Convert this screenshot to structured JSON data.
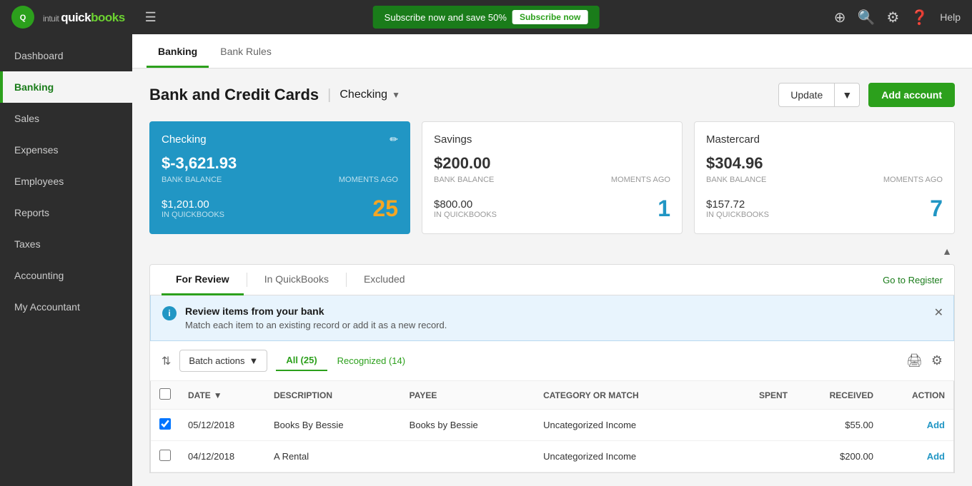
{
  "topnav": {
    "logo_text": "intuit",
    "brand_name": "quickbooks",
    "promo": {
      "text": "Subscribe now and save 50%",
      "button_label": "Subscribe now"
    },
    "help_label": "Help"
  },
  "sidebar": {
    "items": [
      {
        "id": "dashboard",
        "label": "Dashboard",
        "active": false
      },
      {
        "id": "banking",
        "label": "Banking",
        "active": true
      },
      {
        "id": "sales",
        "label": "Sales",
        "active": false
      },
      {
        "id": "expenses",
        "label": "Expenses",
        "active": false
      },
      {
        "id": "employees",
        "label": "Employees",
        "active": false
      },
      {
        "id": "reports",
        "label": "Reports",
        "active": false
      },
      {
        "id": "taxes",
        "label": "Taxes",
        "active": false
      },
      {
        "id": "accounting",
        "label": "Accounting",
        "active": false
      },
      {
        "id": "my-accountant",
        "label": "My Accountant",
        "active": false
      }
    ]
  },
  "tabs": [
    {
      "id": "banking",
      "label": "Banking",
      "active": true
    },
    {
      "id": "bank-rules",
      "label": "Bank Rules",
      "active": false
    }
  ],
  "page": {
    "title": "Bank and Credit Cards",
    "separator": "|",
    "account_selector": "Checking",
    "update_btn": "Update",
    "add_account_btn": "Add account"
  },
  "account_cards": [
    {
      "id": "checking",
      "name": "Checking",
      "active": true,
      "bank_balance": "$-3,621.93",
      "balance_label": "BANK BALANCE",
      "updated": "Moments ago",
      "qb_balance": "$1,201.00",
      "qb_label": "IN QUICKBOOKS",
      "count": "25",
      "count_color": "orange"
    },
    {
      "id": "savings",
      "name": "Savings",
      "active": false,
      "bank_balance": "$200.00",
      "balance_label": "BANK BALANCE",
      "updated": "Moments ago",
      "qb_balance": "$800.00",
      "qb_label": "IN QUICKBOOKS",
      "count": "1",
      "count_color": "blue"
    },
    {
      "id": "mastercard",
      "name": "Mastercard",
      "active": false,
      "bank_balance": "$304.96",
      "balance_label": "BANK BALANCE",
      "updated": "Moments ago",
      "qb_balance": "$157.72",
      "qb_label": "IN QUICKBOOKS",
      "count": "7",
      "count_color": "blue"
    }
  ],
  "review_tabs": [
    {
      "id": "for-review",
      "label": "For Review",
      "active": true
    },
    {
      "id": "in-quickbooks",
      "label": "In QuickBooks",
      "active": false
    },
    {
      "id": "excluded",
      "label": "Excluded",
      "active": false
    }
  ],
  "go_to_register": "Go to Register",
  "info_banner": {
    "title": "Review items from your bank",
    "description": "Match each item to an existing record or add it as a new record."
  },
  "toolbar": {
    "batch_actions_label": "Batch actions",
    "filter_all": "All (25)",
    "filter_recognized": "Recognized (14)"
  },
  "table": {
    "columns": [
      {
        "id": "date",
        "label": "DATE",
        "sortable": true
      },
      {
        "id": "description",
        "label": "DESCRIPTION"
      },
      {
        "id": "payee",
        "label": "PAYEE"
      },
      {
        "id": "category",
        "label": "CATEGORY OR MATCH"
      },
      {
        "id": "spent",
        "label": "SPENT",
        "align": "right"
      },
      {
        "id": "received",
        "label": "RECEIVED",
        "align": "right"
      },
      {
        "id": "action",
        "label": "ACTION",
        "align": "right"
      }
    ],
    "rows": [
      {
        "checked": true,
        "date": "05/12/2018",
        "description": "Books By Bessie",
        "payee": "Books by Bessie",
        "category": "Uncategorized Income",
        "spent": "",
        "received": "$55.00",
        "action": "Add"
      },
      {
        "checked": false,
        "date": "04/12/2018",
        "description": "A Rental",
        "payee": "",
        "category": "Uncategorized Income",
        "spent": "",
        "received": "$200.00",
        "action": "Add"
      }
    ]
  }
}
